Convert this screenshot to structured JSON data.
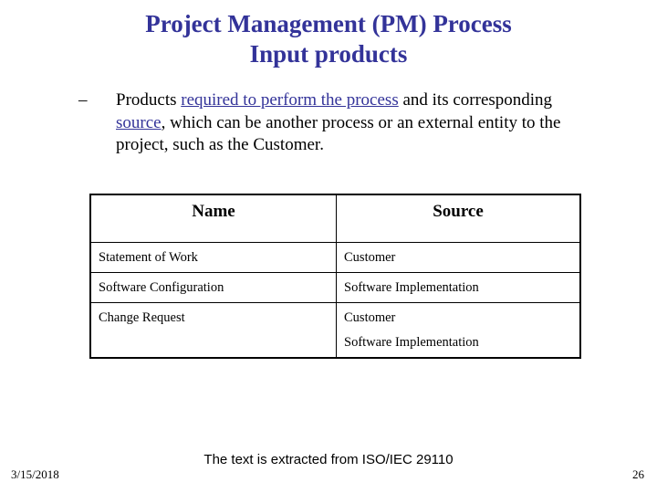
{
  "slide": {
    "background_color": "#ffffff",
    "accent_color": "#333399",
    "text_color": "#000000"
  },
  "title": {
    "line1": "Project Management (PM) Process",
    "line2": "Input products"
  },
  "body": {
    "bullet_marker": "–",
    "paragraph": {
      "part1": "Products ",
      "emph1": "required to perform the process",
      "part2": " and its corresponding ",
      "emph2": "source",
      "part3": ", which can be another process or an external entity to the project, such as the Customer."
    }
  },
  "table": {
    "headers": [
      "Name",
      "Source"
    ],
    "rows": [
      {
        "name": "Statement of Work",
        "source_lines": [
          "Customer"
        ]
      },
      {
        "name": "Software Configuration",
        "source_lines": [
          "Software Implementation"
        ]
      },
      {
        "name": "Change Request",
        "source_lines": [
          "Customer",
          "Software Implementation"
        ]
      }
    ]
  },
  "footer": {
    "note": "The text is extracted from ISO/IEC 29110",
    "date": "3/15/2018",
    "page_number": "26"
  }
}
